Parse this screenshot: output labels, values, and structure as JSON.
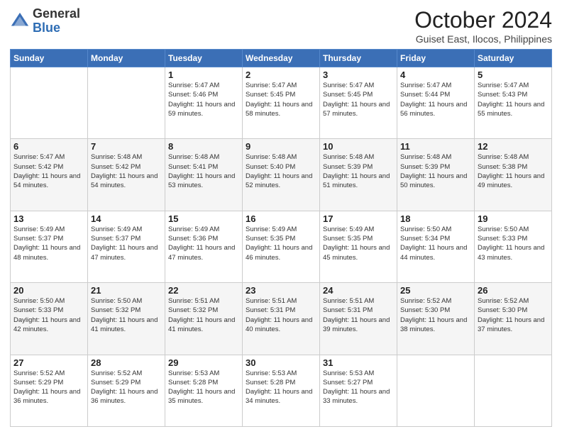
{
  "header": {
    "logo": {
      "general": "General",
      "blue": "Blue"
    },
    "month": "October 2024",
    "location": "Guiset East, Ilocos, Philippines"
  },
  "days_of_week": [
    "Sunday",
    "Monday",
    "Tuesday",
    "Wednesday",
    "Thursday",
    "Friday",
    "Saturday"
  ],
  "weeks": [
    [
      {
        "day": "",
        "content": ""
      },
      {
        "day": "",
        "content": ""
      },
      {
        "day": "1",
        "sunrise": "Sunrise: 5:47 AM",
        "sunset": "Sunset: 5:46 PM",
        "daylight": "Daylight: 11 hours and 59 minutes."
      },
      {
        "day": "2",
        "sunrise": "Sunrise: 5:47 AM",
        "sunset": "Sunset: 5:45 PM",
        "daylight": "Daylight: 11 hours and 58 minutes."
      },
      {
        "day": "3",
        "sunrise": "Sunrise: 5:47 AM",
        "sunset": "Sunset: 5:45 PM",
        "daylight": "Daylight: 11 hours and 57 minutes."
      },
      {
        "day": "4",
        "sunrise": "Sunrise: 5:47 AM",
        "sunset": "Sunset: 5:44 PM",
        "daylight": "Daylight: 11 hours and 56 minutes."
      },
      {
        "day": "5",
        "sunrise": "Sunrise: 5:47 AM",
        "sunset": "Sunset: 5:43 PM",
        "daylight": "Daylight: 11 hours and 55 minutes."
      }
    ],
    [
      {
        "day": "6",
        "sunrise": "Sunrise: 5:47 AM",
        "sunset": "Sunset: 5:42 PM",
        "daylight": "Daylight: 11 hours and 54 minutes."
      },
      {
        "day": "7",
        "sunrise": "Sunrise: 5:48 AM",
        "sunset": "Sunset: 5:42 PM",
        "daylight": "Daylight: 11 hours and 54 minutes."
      },
      {
        "day": "8",
        "sunrise": "Sunrise: 5:48 AM",
        "sunset": "Sunset: 5:41 PM",
        "daylight": "Daylight: 11 hours and 53 minutes."
      },
      {
        "day": "9",
        "sunrise": "Sunrise: 5:48 AM",
        "sunset": "Sunset: 5:40 PM",
        "daylight": "Daylight: 11 hours and 52 minutes."
      },
      {
        "day": "10",
        "sunrise": "Sunrise: 5:48 AM",
        "sunset": "Sunset: 5:39 PM",
        "daylight": "Daylight: 11 hours and 51 minutes."
      },
      {
        "day": "11",
        "sunrise": "Sunrise: 5:48 AM",
        "sunset": "Sunset: 5:39 PM",
        "daylight": "Daylight: 11 hours and 50 minutes."
      },
      {
        "day": "12",
        "sunrise": "Sunrise: 5:48 AM",
        "sunset": "Sunset: 5:38 PM",
        "daylight": "Daylight: 11 hours and 49 minutes."
      }
    ],
    [
      {
        "day": "13",
        "sunrise": "Sunrise: 5:49 AM",
        "sunset": "Sunset: 5:37 PM",
        "daylight": "Daylight: 11 hours and 48 minutes."
      },
      {
        "day": "14",
        "sunrise": "Sunrise: 5:49 AM",
        "sunset": "Sunset: 5:37 PM",
        "daylight": "Daylight: 11 hours and 47 minutes."
      },
      {
        "day": "15",
        "sunrise": "Sunrise: 5:49 AM",
        "sunset": "Sunset: 5:36 PM",
        "daylight": "Daylight: 11 hours and 47 minutes."
      },
      {
        "day": "16",
        "sunrise": "Sunrise: 5:49 AM",
        "sunset": "Sunset: 5:35 PM",
        "daylight": "Daylight: 11 hours and 46 minutes."
      },
      {
        "day": "17",
        "sunrise": "Sunrise: 5:49 AM",
        "sunset": "Sunset: 5:35 PM",
        "daylight": "Daylight: 11 hours and 45 minutes."
      },
      {
        "day": "18",
        "sunrise": "Sunrise: 5:50 AM",
        "sunset": "Sunset: 5:34 PM",
        "daylight": "Daylight: 11 hours and 44 minutes."
      },
      {
        "day": "19",
        "sunrise": "Sunrise: 5:50 AM",
        "sunset": "Sunset: 5:33 PM",
        "daylight": "Daylight: 11 hours and 43 minutes."
      }
    ],
    [
      {
        "day": "20",
        "sunrise": "Sunrise: 5:50 AM",
        "sunset": "Sunset: 5:33 PM",
        "daylight": "Daylight: 11 hours and 42 minutes."
      },
      {
        "day": "21",
        "sunrise": "Sunrise: 5:50 AM",
        "sunset": "Sunset: 5:32 PM",
        "daylight": "Daylight: 11 hours and 41 minutes."
      },
      {
        "day": "22",
        "sunrise": "Sunrise: 5:51 AM",
        "sunset": "Sunset: 5:32 PM",
        "daylight": "Daylight: 11 hours and 41 minutes."
      },
      {
        "day": "23",
        "sunrise": "Sunrise: 5:51 AM",
        "sunset": "Sunset: 5:31 PM",
        "daylight": "Daylight: 11 hours and 40 minutes."
      },
      {
        "day": "24",
        "sunrise": "Sunrise: 5:51 AM",
        "sunset": "Sunset: 5:31 PM",
        "daylight": "Daylight: 11 hours and 39 minutes."
      },
      {
        "day": "25",
        "sunrise": "Sunrise: 5:52 AM",
        "sunset": "Sunset: 5:30 PM",
        "daylight": "Daylight: 11 hours and 38 minutes."
      },
      {
        "day": "26",
        "sunrise": "Sunrise: 5:52 AM",
        "sunset": "Sunset: 5:30 PM",
        "daylight": "Daylight: 11 hours and 37 minutes."
      }
    ],
    [
      {
        "day": "27",
        "sunrise": "Sunrise: 5:52 AM",
        "sunset": "Sunset: 5:29 PM",
        "daylight": "Daylight: 11 hours and 36 minutes."
      },
      {
        "day": "28",
        "sunrise": "Sunrise: 5:52 AM",
        "sunset": "Sunset: 5:29 PM",
        "daylight": "Daylight: 11 hours and 36 minutes."
      },
      {
        "day": "29",
        "sunrise": "Sunrise: 5:53 AM",
        "sunset": "Sunset: 5:28 PM",
        "daylight": "Daylight: 11 hours and 35 minutes."
      },
      {
        "day": "30",
        "sunrise": "Sunrise: 5:53 AM",
        "sunset": "Sunset: 5:28 PM",
        "daylight": "Daylight: 11 hours and 34 minutes."
      },
      {
        "day": "31",
        "sunrise": "Sunrise: 5:53 AM",
        "sunset": "Sunset: 5:27 PM",
        "daylight": "Daylight: 11 hours and 33 minutes."
      },
      {
        "day": "",
        "content": ""
      },
      {
        "day": "",
        "content": ""
      }
    ]
  ]
}
